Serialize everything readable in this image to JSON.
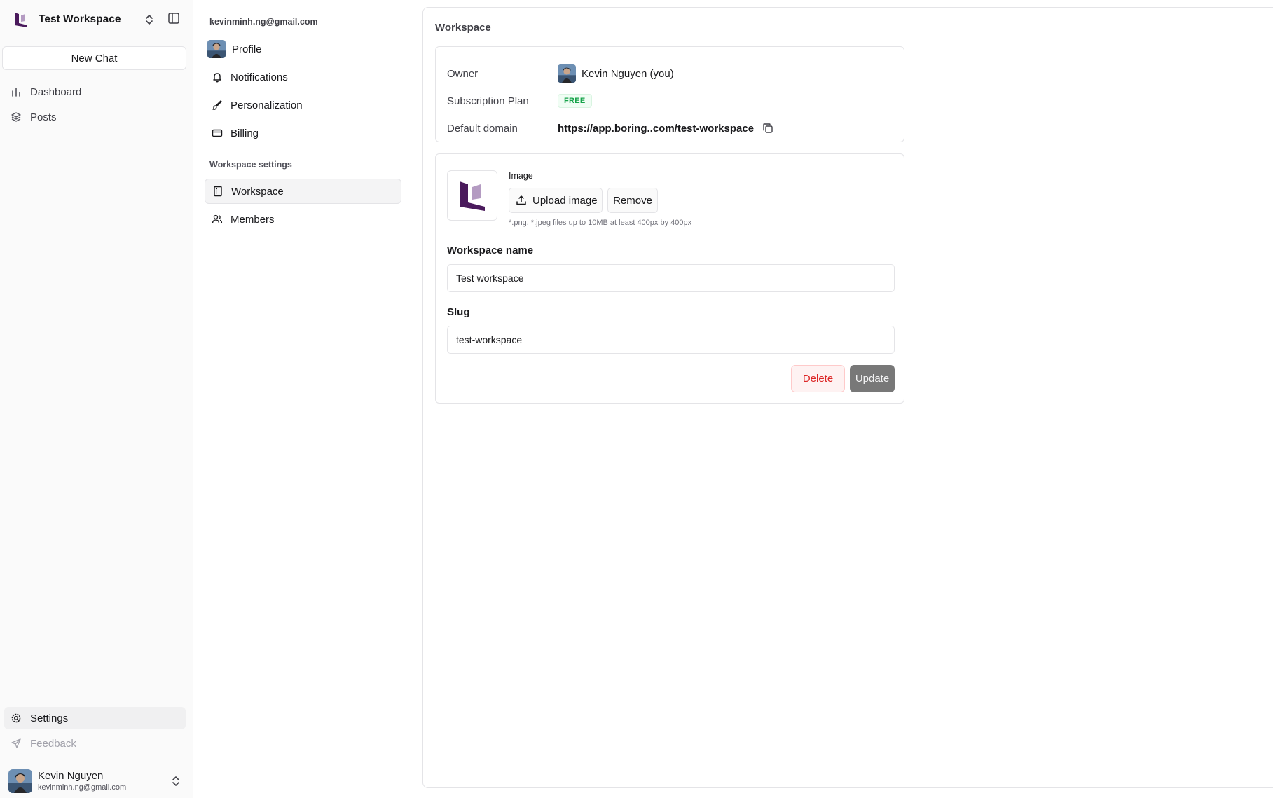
{
  "workspace_switcher": {
    "name": "Test Workspace"
  },
  "sidebar": {
    "new_chat_label": "New Chat",
    "items": [
      {
        "label": "Dashboard",
        "icon": "chart-bar-icon"
      },
      {
        "label": "Posts",
        "icon": "layers-icon"
      }
    ],
    "bottom_items": [
      {
        "label": "Settings",
        "icon": "gear-icon"
      },
      {
        "label": "Feedback",
        "icon": "send-icon"
      }
    ]
  },
  "user": {
    "name": "Kevin Nguyen",
    "email": "kevinminh.ng@gmail.com"
  },
  "settings_nav": {
    "email": "kevinminh.ng@gmail.com",
    "account_items": [
      {
        "label": "Profile",
        "icon": "avatar"
      },
      {
        "label": "Notifications",
        "icon": "bell-icon"
      },
      {
        "label": "Personalization",
        "icon": "brush-icon"
      },
      {
        "label": "Billing",
        "icon": "credit-card-icon"
      }
    ],
    "section_title": "Workspace settings",
    "workspace_items": [
      {
        "label": "Workspace",
        "icon": "building-icon"
      },
      {
        "label": "Members",
        "icon": "users-icon"
      }
    ]
  },
  "main": {
    "title": "Workspace",
    "info": {
      "owner_label": "Owner",
      "owner_value": "Kevin Nguyen (you)",
      "plan_label": "Subscription Plan",
      "plan_value": "FREE",
      "domain_label": "Default domain",
      "domain_value": "https://app.boring..com/test-workspace"
    },
    "form": {
      "image_label": "Image",
      "upload_label": "Upload image",
      "remove_label": "Remove",
      "image_hint": "*.png, *.jpeg files up to 10MB at least 400px by 400px",
      "name_label": "Workspace name",
      "name_value": "Test workspace",
      "slug_label": "Slug",
      "slug_value": "test-workspace",
      "delete_label": "Delete",
      "update_label": "Update"
    }
  },
  "colors": {
    "brand_purple": "#4a1a5c",
    "brand_purple_light": "#b49bc2",
    "badge_green": "#16a34a",
    "danger_red": "#dc2626",
    "update_gray": "#787878"
  }
}
